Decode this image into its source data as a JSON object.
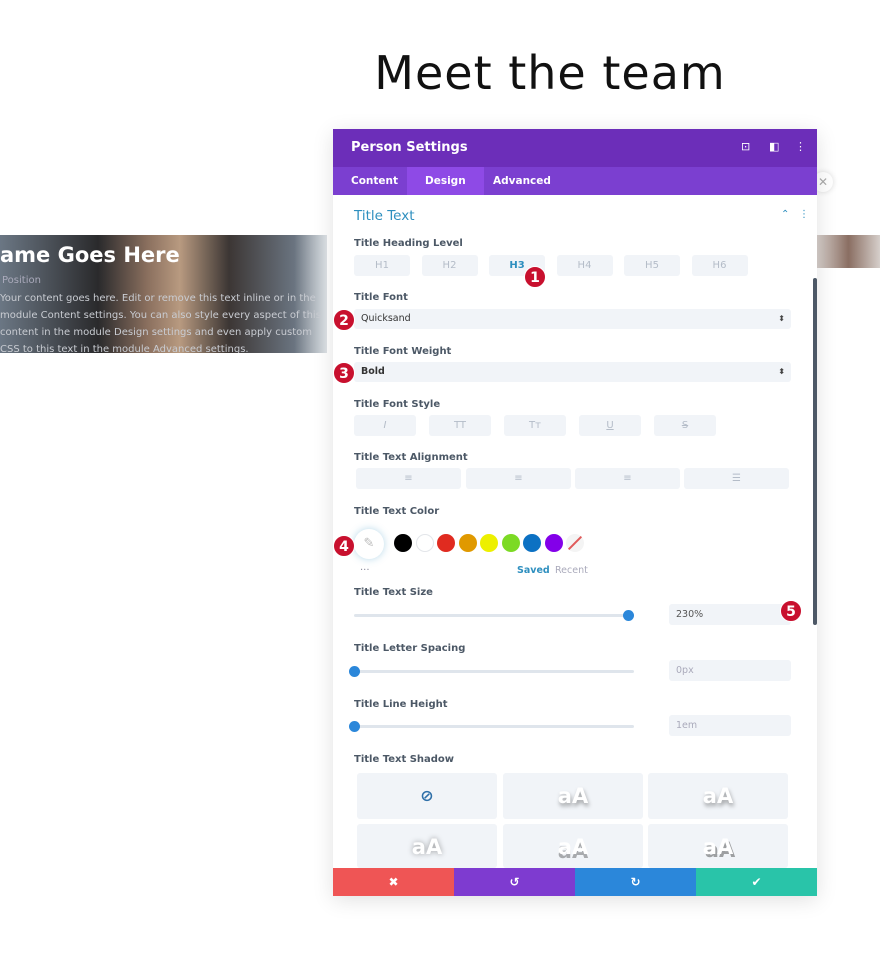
{
  "page": {
    "title": "Meet the team"
  },
  "card": {
    "name": "ame Goes Here",
    "position": "Position",
    "body": "Your content goes here. Edit or remove this text inline or in the module Content settings. You can also style every aspect of this content in the module Design settings and even apply custom CSS to this text in the module Advanced settings."
  },
  "panel": {
    "title": "Person Settings",
    "header_icons": [
      "focus-icon",
      "split-view-icon",
      "more-icon"
    ],
    "tabs": [
      {
        "label": "Content"
      },
      {
        "label": "Design",
        "active": true
      },
      {
        "label": "Advanced"
      }
    ],
    "section": "Title Text",
    "heading_level": {
      "label": "Title Heading Level",
      "options": [
        "H1",
        "H2",
        "H3",
        "H4",
        "H5",
        "H6"
      ],
      "selected": "H3"
    },
    "font": {
      "label": "Title Font",
      "value": "Quicksand"
    },
    "weight": {
      "label": "Title Font Weight",
      "value": "Bold"
    },
    "style": {
      "label": "Title Font Style",
      "options": [
        "I",
        "TT",
        "Tт",
        "U",
        "S"
      ]
    },
    "alignment": {
      "label": "Title Text Alignment",
      "options": [
        "left",
        "center",
        "right",
        "justify"
      ]
    },
    "color": {
      "label": "Title Text Color",
      "swatches": [
        "#000000",
        "#ffffff",
        "#e02b20",
        "#e09900",
        "#edf000",
        "#7cda24",
        "#0c71c3",
        "#8300e9"
      ],
      "saved": "Saved",
      "recent": "Recent",
      "more": "..."
    },
    "size": {
      "label": "Title Text Size",
      "value": "230%",
      "slider": 0.98
    },
    "letter_spacing": {
      "label": "Title Letter Spacing",
      "value": "0px",
      "slider": 0
    },
    "line_height": {
      "label": "Title Line Height",
      "value": "1em",
      "slider": 0
    },
    "shadow": {
      "label": "Title Text Shadow",
      "options": [
        "none",
        "aA",
        "aA",
        "aA",
        "aA",
        "aA"
      ]
    },
    "footer": {
      "colors": [
        "#ef5555",
        "#7e3bd0",
        "#2b87da",
        "#29c4a9"
      ],
      "icons": [
        "close-icon",
        "undo-icon",
        "redo-icon",
        "check-icon"
      ]
    }
  },
  "badges": [
    "1",
    "2",
    "3",
    "4",
    "5"
  ],
  "accent": "#2e8fbf"
}
